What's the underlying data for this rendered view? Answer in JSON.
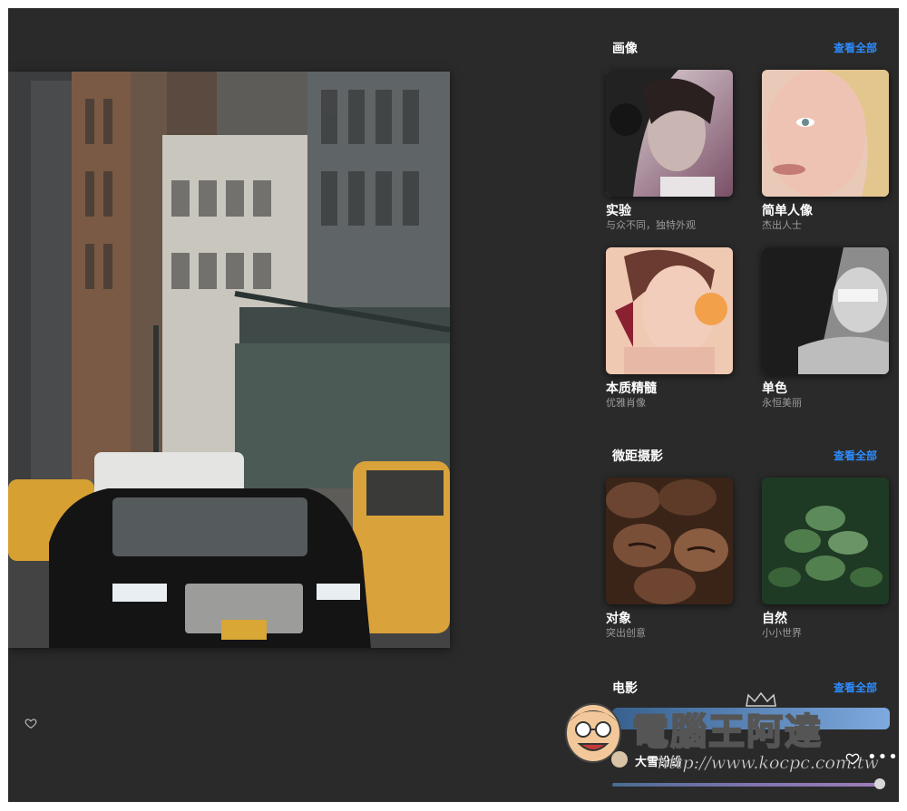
{
  "sections": [
    {
      "title": "画像",
      "view_all": "查看全部"
    },
    {
      "title": "微距摄影",
      "view_all": "查看全部"
    },
    {
      "title": "电影",
      "view_all": "查看全部"
    }
  ],
  "cards": [
    {
      "title": "实验",
      "subtitle": "与众不同，独特外观"
    },
    {
      "title": "简单人像",
      "subtitle": "杰出人士"
    },
    {
      "title": "本质精髓",
      "subtitle": "优雅肖像"
    },
    {
      "title": "单色",
      "subtitle": "永恒美丽"
    },
    {
      "title": "对象",
      "subtitle": "突出创意"
    },
    {
      "title": "自然",
      "subtitle": "小小世界"
    }
  ],
  "author": {
    "name": "大雪纷纷"
  },
  "icons": {
    "like": "heart-icon",
    "more": "more-icon"
  },
  "slider": {
    "value": 1.0
  },
  "watermark": {
    "title": "電腦王阿達",
    "url": "http://www.kocpc.com.tw"
  },
  "colors": {
    "background": "#2a2a2a",
    "accent": "#2c8cff",
    "subtitle": "#9a9a9a"
  }
}
